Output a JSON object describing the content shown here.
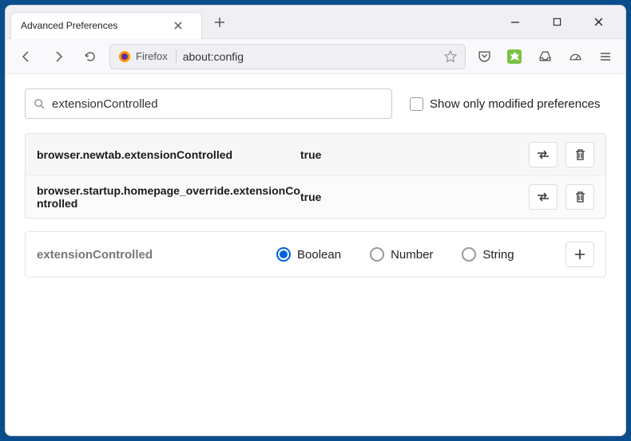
{
  "tab": {
    "title": "Advanced Preferences"
  },
  "urlbar": {
    "identity": "Firefox",
    "url": "about:config"
  },
  "search": {
    "value": "extensionControlled",
    "checkbox_label": "Show only modified preferences"
  },
  "prefs": [
    {
      "name": "browser.newtab.extensionControlled",
      "value": "true"
    },
    {
      "name": "browser.startup.homepage_override.extensionControlled",
      "value": "true"
    }
  ],
  "new_pref": {
    "name": "extensionControlled",
    "types": {
      "boolean": "Boolean",
      "number": "Number",
      "string": "String"
    }
  }
}
